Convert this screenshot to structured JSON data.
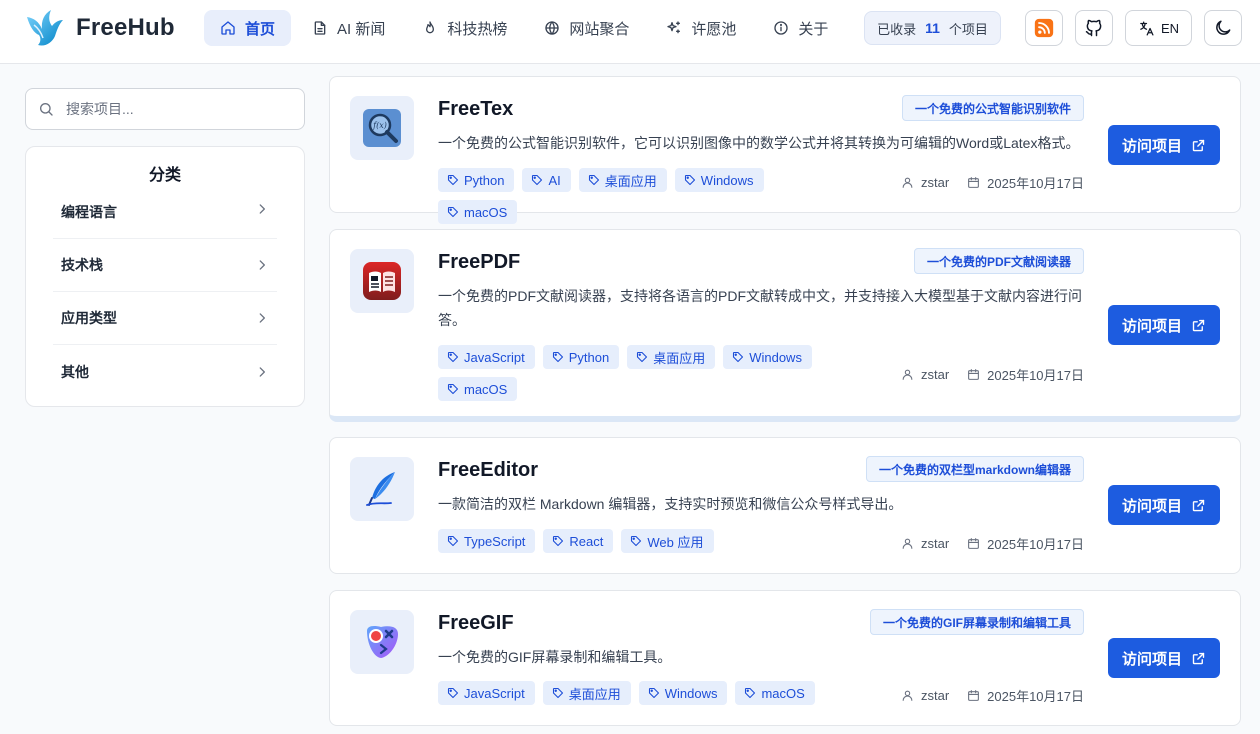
{
  "brand": {
    "name": "FreeHub",
    "logo_icon": "freehub-bird-logo"
  },
  "nav": [
    {
      "label": "首页",
      "icon": "home-icon",
      "active": true
    },
    {
      "label": "AI 新闻",
      "icon": "document-icon",
      "active": false
    },
    {
      "label": "科技热榜",
      "icon": "flame-icon",
      "active": false
    },
    {
      "label": "网站聚合",
      "icon": "globe-icon",
      "active": false
    },
    {
      "label": "许愿池",
      "icon": "sparkles-icon",
      "active": false
    },
    {
      "label": "关于",
      "icon": "info-icon",
      "active": false
    }
  ],
  "header_right": {
    "count_prefix": "已收录",
    "count_value": "11",
    "count_suffix": "个项目",
    "lang_label": "EN",
    "icons": [
      "rss-icon",
      "github-icon",
      "translate-icon",
      "moon-icon"
    ]
  },
  "search": {
    "placeholder": "搜索项目..."
  },
  "categories": {
    "title": "分类",
    "items": [
      "编程语言",
      "技术栈",
      "应用类型",
      "其他"
    ]
  },
  "projects": [
    {
      "name": "FreeTex",
      "badge": "一个免费的公式智能识别软件",
      "description": "一个免费的公式智能识别软件，它可以识别图像中的数学公式并将其转换为可编辑的Word或Latex格式。",
      "tags": [
        "Python",
        "AI",
        "桌面应用",
        "Windows",
        "macOS"
      ],
      "author": "zstar",
      "date": "2025年10月17日",
      "button": "访问项目",
      "icon": "formula-magnifier-icon"
    },
    {
      "name": "FreePDF",
      "badge": "一个免费的PDF文献阅读器",
      "description": "一个免费的PDF文献阅读器，支持将各语言的PDF文献转成中文，并支持接入大模型基于文献内容进行问答。",
      "tags": [
        "JavaScript",
        "Python",
        "桌面应用",
        "Windows",
        "macOS"
      ],
      "author": "zstar",
      "date": "2025年10月17日",
      "button": "访问项目",
      "icon": "pdf-book-icon"
    },
    {
      "name": "FreeEditor",
      "badge": "一个免费的双栏型markdown编辑器",
      "description": "一款简洁的双栏 Markdown 编辑器，支持实时预览和微信公众号样式导出。",
      "tags": [
        "TypeScript",
        "React",
        "Web 应用"
      ],
      "author": "zstar",
      "date": "2025年10月17日",
      "button": "访问项目",
      "icon": "feather-pen-icon"
    },
    {
      "name": "FreeGIF",
      "badge": "一个免费的GIF屏幕录制和编辑工具",
      "description": "一个免费的GIF屏幕录制和编辑工具。",
      "tags": [
        "JavaScript",
        "桌面应用",
        "Windows",
        "macOS"
      ],
      "author": "zstar",
      "date": "2025年10月17日",
      "button": "访问项目",
      "icon": "gif-recorder-icon"
    }
  ],
  "colors": {
    "accent": "#1d5ce0",
    "tag_bg": "#e6eefc",
    "page_bg": "#f8fafc"
  }
}
